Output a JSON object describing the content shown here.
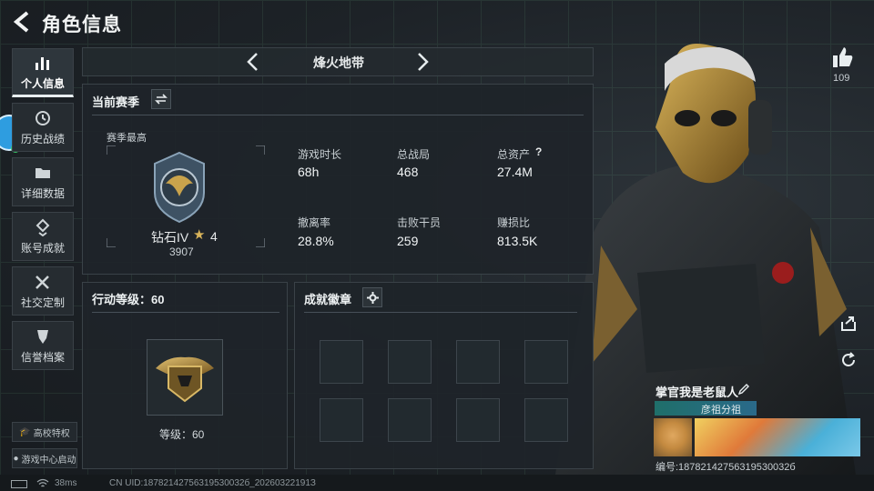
{
  "header": {
    "title": "角色信息"
  },
  "sidebar": {
    "items": [
      {
        "label": "个人信息"
      },
      {
        "label": "历史战绩"
      },
      {
        "label": "详细数据"
      },
      {
        "label": "账号成就"
      },
      {
        "label": "社交定制"
      },
      {
        "label": "信誉档案"
      }
    ],
    "campus_label": "高校特权",
    "gamecenter_label": "游戏中心启动"
  },
  "mode_nav": {
    "current": "烽火地带"
  },
  "season": {
    "title": "当前赛季",
    "best_label": "赛季最高",
    "rank_name": "钻石IV",
    "rank_stars": "4",
    "rank_score": "3907",
    "stats": [
      {
        "label": "游戏时长",
        "value": "68h"
      },
      {
        "label": "总战局",
        "value": "468"
      },
      {
        "label": "总资产",
        "value": "27.4M"
      },
      {
        "label": "撤离率",
        "value": "28.8%"
      },
      {
        "label": "击败干员",
        "value": "259"
      },
      {
        "label": "赚损比",
        "value": "813.5K"
      }
    ],
    "help_icon": "?"
  },
  "action_level": {
    "title": "行动等级：60",
    "level_text": "等级：60"
  },
  "badges": {
    "title": "成就徽章",
    "slots": 8
  },
  "likes": {
    "count": "109"
  },
  "player": {
    "name": "掌官我是老鼠人",
    "group": "彦祖分祖",
    "id_text": "编号:18782142756319530032б"
  },
  "status": {
    "ping": "38ms",
    "uid": "CN UID:18782142756319530032б_20260322191З"
  },
  "colors": {
    "accent": "#e8eef0",
    "gold": "#c8a24a",
    "team_bar": "#2a6a8a"
  }
}
